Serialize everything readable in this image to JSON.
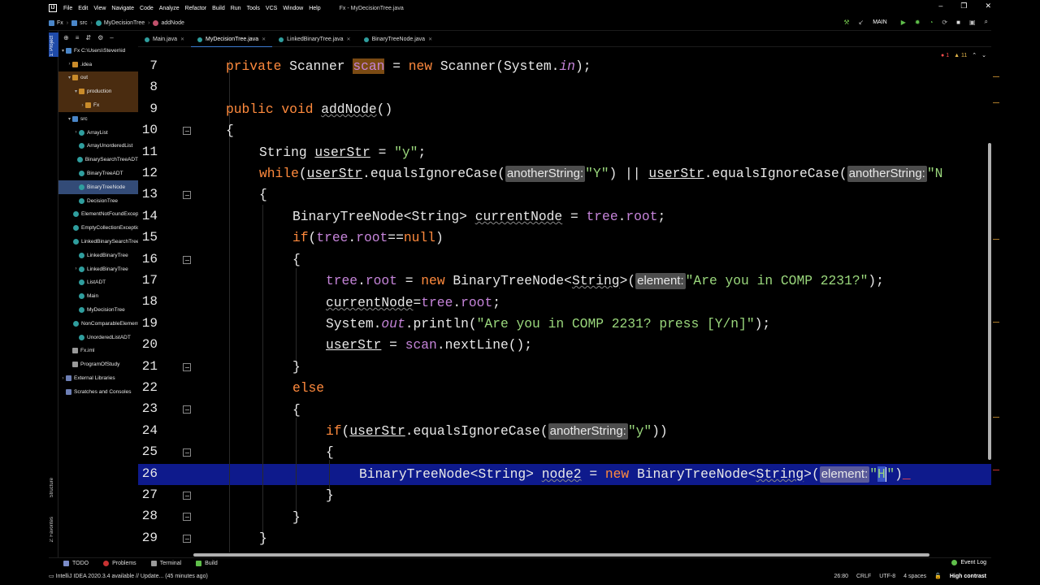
{
  "app": {
    "logo": "IJ",
    "window_title": "Fx - MyDecisionTree.java"
  },
  "menu": [
    "File",
    "Edit",
    "View",
    "Navigate",
    "Code",
    "Analyze",
    "Refactor",
    "Build",
    "Run",
    "Tools",
    "VCS",
    "Window",
    "Help"
  ],
  "breadcrumb": [
    "Fx",
    "src",
    "MyDecisionTree",
    "addNode"
  ],
  "toolbar": {
    "run_config": "MAIN"
  },
  "side_labels": {
    "project": "1: Project",
    "structure": "Structure",
    "favorites": "2: Favorites"
  },
  "project_tree": [
    {
      "label": "Fx  C:\\Users\\Steven\\id",
      "icon": "folder-blue",
      "arrow": "▾",
      "indent": 0
    },
    {
      "label": ".idea",
      "icon": "folder",
      "arrow": "›",
      "indent": 1
    },
    {
      "label": "out",
      "icon": "folder",
      "arrow": "▾",
      "indent": 1,
      "state": "excluded"
    },
    {
      "label": "production",
      "icon": "folder",
      "arrow": "▾",
      "indent": 2,
      "state": "excluded"
    },
    {
      "label": "Fx",
      "icon": "folder",
      "arrow": "›",
      "indent": 3,
      "state": "excluded"
    },
    {
      "label": "src",
      "icon": "folder-blue",
      "arrow": "▾",
      "indent": 1
    },
    {
      "label": "ArrayList",
      "icon": "java",
      "arrow": "›",
      "indent": 2
    },
    {
      "label": "ArrayUnorderedList",
      "icon": "java",
      "arrow": "",
      "indent": 2
    },
    {
      "label": "BinarySearchTreeADT",
      "icon": "java",
      "arrow": "",
      "indent": 2
    },
    {
      "label": "BinaryTreeADT",
      "icon": "java",
      "arrow": "",
      "indent": 2
    },
    {
      "label": "BinaryTreeNode",
      "icon": "java",
      "arrow": "",
      "indent": 2,
      "state": "selected"
    },
    {
      "label": "DecisionTree",
      "icon": "java",
      "arrow": "",
      "indent": 2
    },
    {
      "label": "ElementNotFoundException",
      "icon": "java",
      "arrow": "",
      "indent": 2
    },
    {
      "label": "EmptyCollectionException",
      "icon": "java",
      "arrow": "",
      "indent": 2
    },
    {
      "label": "LinkedBinarySearchTree",
      "icon": "java",
      "arrow": "",
      "indent": 2
    },
    {
      "label": "LinkedBinaryTree",
      "icon": "java",
      "arrow": "",
      "indent": 2
    },
    {
      "label": "LinkedBinaryTree",
      "icon": "java",
      "arrow": "›",
      "indent": 2
    },
    {
      "label": "ListADT",
      "icon": "java",
      "arrow": "",
      "indent": 2
    },
    {
      "label": "Main",
      "icon": "java",
      "arrow": "",
      "indent": 2
    },
    {
      "label": "MyDecisionTree",
      "icon": "java",
      "arrow": "",
      "indent": 2
    },
    {
      "label": "NonComparableElementException",
      "icon": "java",
      "arrow": "",
      "indent": 2
    },
    {
      "label": "UnorderedListADT",
      "icon": "java",
      "arrow": "",
      "indent": 2
    },
    {
      "label": "Fx.iml",
      "icon": "file",
      "arrow": "",
      "indent": 1
    },
    {
      "label": "ProgramOfStudy",
      "icon": "file",
      "arrow": "",
      "indent": 1
    },
    {
      "label": "External Libraries",
      "icon": "lib",
      "arrow": "›",
      "indent": 0
    },
    {
      "label": "Scratches and Consoles",
      "icon": "lib",
      "arrow": "",
      "indent": 0
    }
  ],
  "tabs": [
    {
      "label": "Main.java",
      "active": false
    },
    {
      "label": "MyDecisionTree.java",
      "active": true
    },
    {
      "label": "LinkedBinaryTree.java",
      "active": false
    },
    {
      "label": "BinaryTreeNode.java",
      "active": false
    }
  ],
  "inspections": {
    "errors": "1",
    "warnings": "11"
  },
  "line_numbers": [
    "7",
    "8",
    "9",
    "10",
    "11",
    "12",
    "13",
    "14",
    "15",
    "16",
    "17",
    "18",
    "19",
    "20",
    "21",
    "22",
    "23",
    "24",
    "25",
    "26",
    "27",
    "28",
    "29"
  ],
  "current_line": "26",
  "code": {
    "l7": {
      "private": "private ",
      "type": "Scanner ",
      "scan": "scan",
      "eq": " = ",
      "new": "new ",
      "ctor": "Scanner(System.",
      "in": "in",
      "end": ");"
    },
    "l9": {
      "public": "public ",
      "void": "void ",
      "name": "addNode",
      "end": "()"
    },
    "l10": "{",
    "l11": {
      "type": "String ",
      "var": "userStr",
      "eq": " = ",
      "str": "\"y\"",
      "end": ";"
    },
    "l12": {
      "while": "while",
      "open": "(",
      "var": "userStr",
      "call": ".equalsIgnoreCase(",
      "hint": "anotherString:",
      "str": "\"Y\"",
      "mid": ") || ",
      "var2": "userStr",
      "call2": ".equalsIgnoreCase(",
      "hint2": "anotherString:",
      "str2": "\"N"
    },
    "l13": "{",
    "l14": {
      "type": "BinaryTreeNode<String> ",
      "var": "currentNode",
      "eq": " = ",
      "tree": "tree",
      "dot": ".",
      "root": "root",
      "end": ";"
    },
    "l15": {
      "if": "if",
      "open": "(",
      "tree": "tree",
      "dot": ".",
      "root": "root",
      "eq": "==",
      "null": "null",
      "end": ")"
    },
    "l16": "{",
    "l17": {
      "tree": "tree",
      "dot": ".",
      "root": "root",
      "eq": " = ",
      "new": "new ",
      "ctor": "BinaryTreeNode<",
      "gen": "String",
      "ctor2": ">(",
      "hint": "element:",
      "str": "\"Are you in COMP 2231?\"",
      "end": ");"
    },
    "l18": {
      "var": "currentNode",
      "eq": "=",
      "tree": "tree",
      "dot": ".",
      "root": "root",
      "end": ";"
    },
    "l19": {
      "sys": "System.",
      "out": "out",
      "call": ".println(",
      "str": "\"Are you in COMP 2231? press [Y/n]\"",
      "end": ");"
    },
    "l20": {
      "var": "userStr",
      "eq": " = ",
      "scan": "scan",
      "call": ".nextLine();"
    },
    "l21": "}",
    "l22": "else",
    "l23": "{",
    "l24": {
      "if": "if",
      "open": "(",
      "var": "userStr",
      "call": ".equalsIgnoreCase(",
      "hint": "anotherString:",
      "str": "\"y\"",
      "end": "))"
    },
    "l25": "{",
    "l26": {
      "type": "BinaryTreeNode<String> ",
      "var": "node2",
      "eq": " = ",
      "new": "new ",
      "ctor": "BinaryTreeNode<",
      "gen": "String",
      "ctor2": ">(",
      "hint": "element:",
      "q1": "\"",
      "H": "H",
      "q2": "\"",
      "end": ")"
    },
    "l27": "}",
    "l28": "}",
    "l29": "}"
  },
  "bottom_tabs": [
    "TODO",
    "Problems",
    "Terminal",
    "Build"
  ],
  "event_log": "Event Log",
  "status": {
    "message": "IntelliJ IDEA 2020.3.4 available // Update... (45 minutes ago)",
    "position": "26:80",
    "line_sep": "CRLF",
    "encoding": "UTF-8",
    "indent": "4 spaces",
    "theme": "High contrast"
  }
}
